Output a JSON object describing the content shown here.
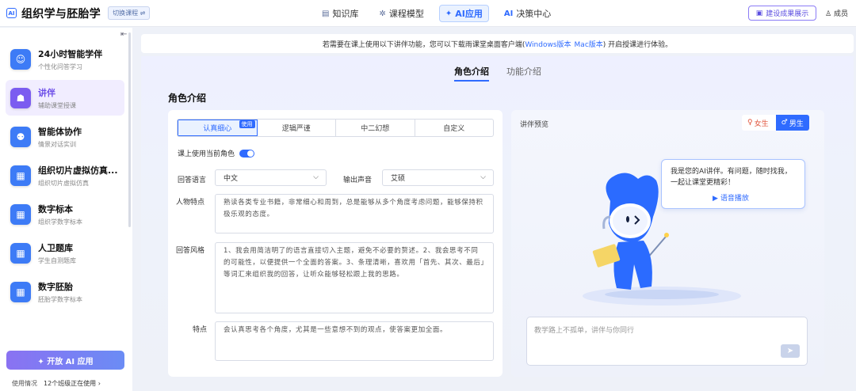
{
  "header": {
    "logo_icon": "AI",
    "brand": "组织学与胚胎学",
    "switch_label": "切换课程 ⇌",
    "nav": [
      {
        "icon": "▤",
        "label": "知识库"
      },
      {
        "icon": "✲",
        "label": "课程模型"
      },
      {
        "icon": "✦",
        "label": "AI应用"
      },
      {
        "icon": "AI",
        "label": "决策中心"
      }
    ],
    "suggest_label": "建设成果展示",
    "member_label": "成员"
  },
  "sidebar": {
    "collapse_icon": "⇤",
    "items": [
      {
        "title": "24小时智能学伴",
        "sub": "个性化问答学习",
        "color": "#3d7bf6"
      },
      {
        "title": "讲伴",
        "sub": "辅助课堂授课",
        "color": "#7b5cf0"
      },
      {
        "title": "智能体协作",
        "sub": "情景对话实训",
        "color": "#3d7bf6"
      },
      {
        "title": "组织切片虚拟仿真...",
        "sub": "组织切片虚拟仿真",
        "color": "#3d7bf6"
      },
      {
        "title": "数字标本",
        "sub": "组织学数字标本",
        "color": "#3d7bf6"
      },
      {
        "title": "人卫题库",
        "sub": "学生自测题库",
        "color": "#3d7bf6"
      },
      {
        "title": "数字胚胎",
        "sub": "胚胎学数字标本",
        "color": "#3d7bf6"
      }
    ],
    "open_ai_label": "✦ 开放 AI 应用",
    "usage_label": "使用情况",
    "usage_value": "12个班级正在使用 ›"
  },
  "notice": {
    "prefix": "若需要在课上使用以下讲伴功能，您可以下载雨课堂桌面客户端(",
    "windows": "Windows版本",
    "mac": "Mac版本",
    "suffix": ") 开启授课进行体验。"
  },
  "tabs": [
    "角色介绍",
    "功能介绍"
  ],
  "section_title": "角色介绍",
  "role_tabs": [
    "认真细心",
    "逻辑严谨",
    "中二幻想",
    "自定义"
  ],
  "role_tab_badge": "使用",
  "toggle_label": "课上使用当前角色",
  "form": {
    "language_label": "回答语言",
    "language_value": "中文",
    "voice_label": "输出声音",
    "voice_value": "艾硕",
    "trait_label": "人物特点",
    "trait_text": "熟读各类专业书籍，非常细心和周到，总是能够从多个角度考虑问题，能够保持积极乐观的态度。",
    "style_label": "回答风格",
    "style_text": "1、我会用简洁明了的语言直接切入主题，避免不必要的赘述。2、我会思考不同的可能性，以便提供一个全面的答案。3、条理清晰，喜欢用「首先、其次、最后」等词汇来组织我的回答，让听众能够轻松跟上我的思路。",
    "feature_label": "特点",
    "feature_text": "会认真思考各个角度，尤其是一些意想不到的观点，使答案更加全面。"
  },
  "preview": {
    "label": "讲伴预览",
    "female": "女生",
    "male": "男生",
    "female_icon": "♀",
    "male_icon": "♂",
    "bubble": "我是您的AI讲伴。有问题，随时找我，一起让课堂更精彩！",
    "speak": "语音播放",
    "speak_icon": "▶",
    "chat_placeholder": "教学路上不孤单，讲伴与你同行",
    "send_icon": "send-icon"
  }
}
